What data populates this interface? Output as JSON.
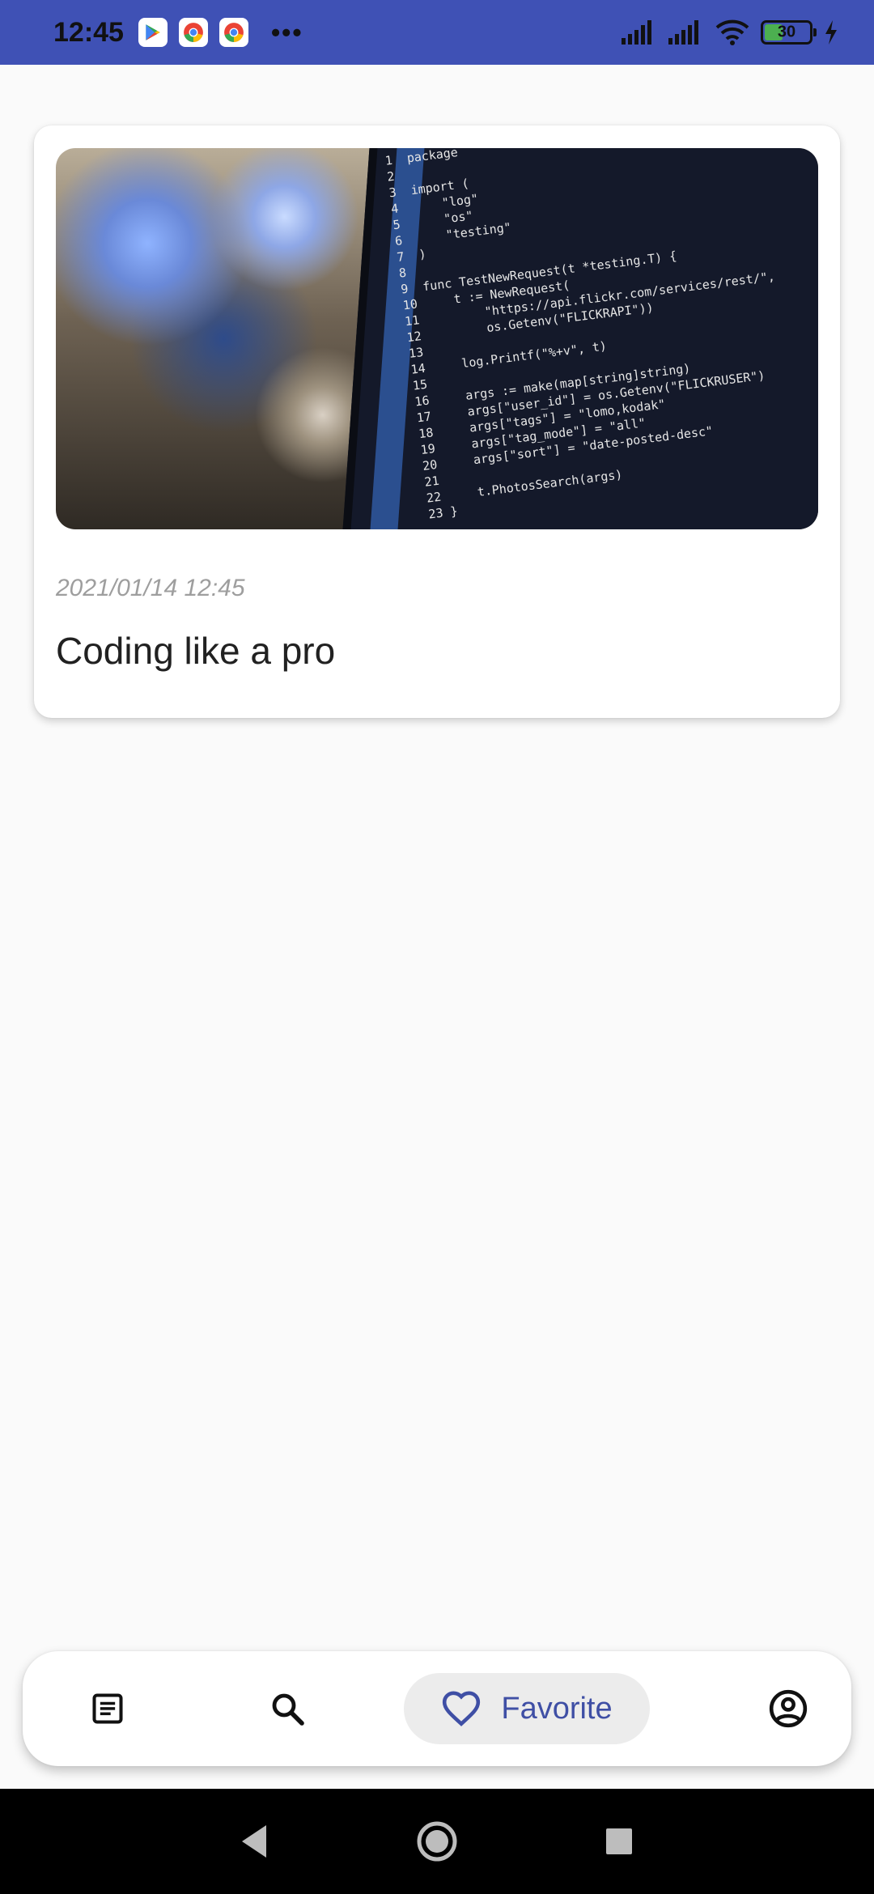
{
  "status_bar": {
    "time": "12:45",
    "app_icons": [
      "play-store-icon",
      "chrome-icon",
      "chrome-icon"
    ],
    "more": "•••",
    "battery_level": "30",
    "icons": [
      "signal-icon",
      "signal-icon",
      "wifi-icon",
      "battery-icon",
      "charging-icon"
    ],
    "accent_color": "#3f51b5"
  },
  "post_card": {
    "image_alt": "code-on-monitor-image",
    "code_lines": [
      "1  package",
      "2",
      "3  import (",
      "4      \"log\"",
      "5      \"os\"",
      "6      \"testing\"",
      "7  )",
      "8",
      "9  func TestNewRequest(t *testing.T) {",
      "10     t := NewRequest(",
      "11         \"https://api.flickr.com/services/rest/\",",
      "12         os.Getenv(\"FLICKRAPI\"))",
      "13",
      "14     log.Printf(\"%+v\", t)",
      "15",
      "16     args := make(map[string]string)",
      "17     args[\"user_id\"] = os.Getenv(\"FLICKRUSER\")",
      "18     args[\"tags\"] = \"lomo,kodak\"",
      "19     args[\"tag_mode\"] = \"all\"",
      "20     args[\"sort\"] = \"date-posted-desc\"",
      "21",
      "22     t.PhotosSearch(args)",
      "23 }"
    ],
    "date": "2021/01/14 12:45",
    "title": "Coding like a pro"
  },
  "bottom_nav": {
    "items": [
      {
        "name": "feed",
        "icon": "article-icon",
        "selected": false
      },
      {
        "name": "search",
        "icon": "search-icon",
        "selected": false
      },
      {
        "name": "favorite",
        "icon": "heart-icon",
        "label": "Favorite",
        "selected": true
      },
      {
        "name": "profile",
        "icon": "account-circle-icon",
        "selected": false
      }
    ],
    "selected_color": "#3f4fa5"
  },
  "system_nav": {
    "icons": [
      "back-icon",
      "home-icon",
      "recents-icon"
    ]
  }
}
